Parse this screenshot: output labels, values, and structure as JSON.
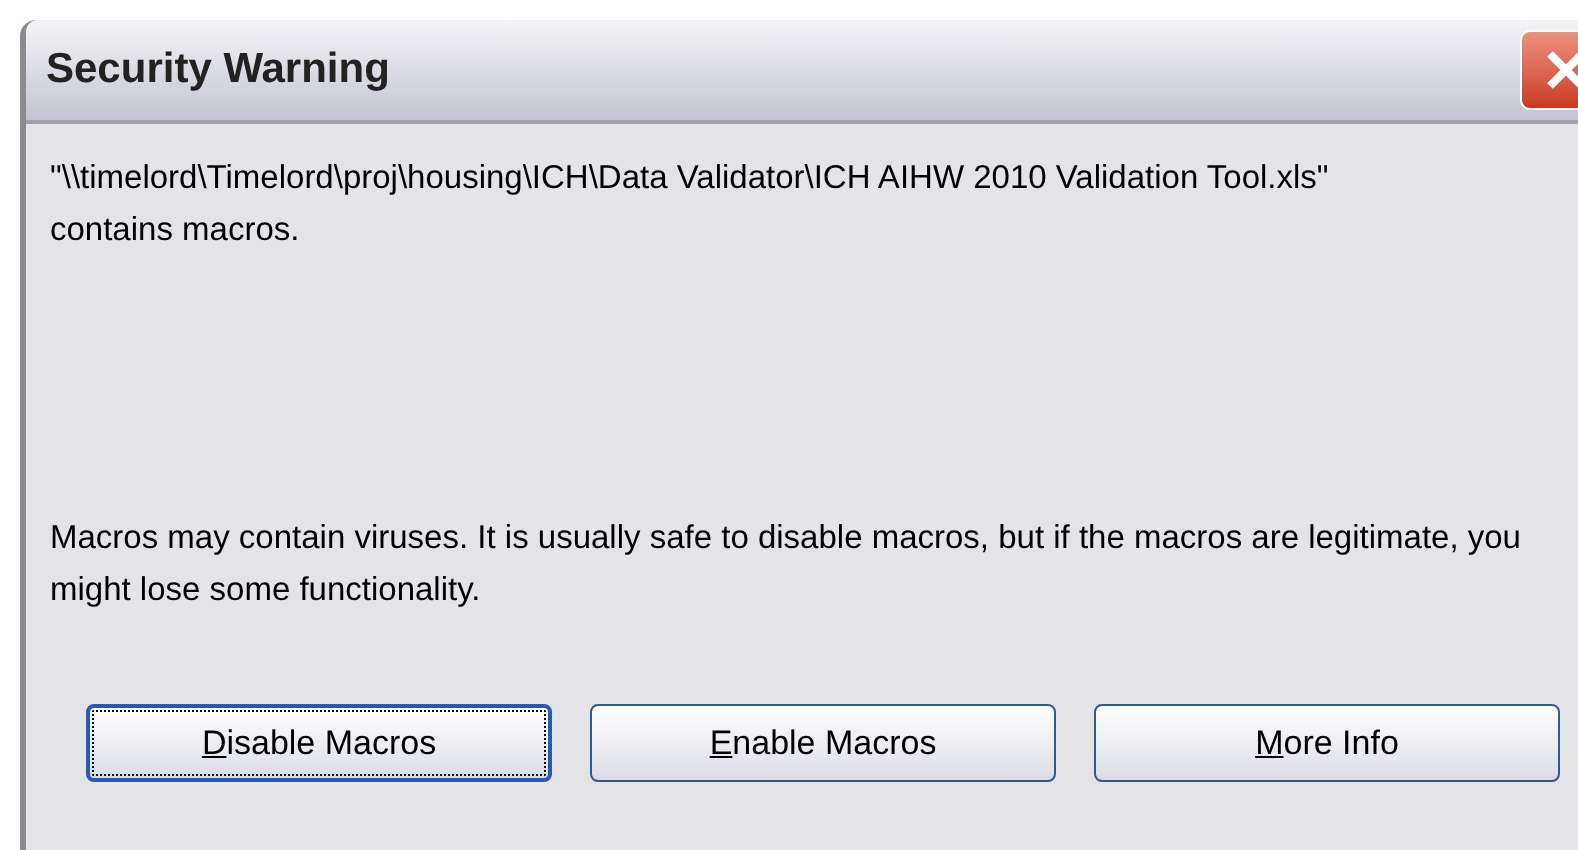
{
  "window": {
    "title": "Security Warning"
  },
  "message": {
    "file_notice": "\"\\\\timelord\\Timelord\\proj\\housing\\ICH\\Data Validator\\ICH AIHW 2010 Validation Tool.xls\" contains macros.",
    "warning": "Macros may contain viruses. It is usually safe to disable macros, but if the macros are legitimate, you might lose some functionality."
  },
  "buttons": [
    {
      "label": "Disable Macros",
      "focused": true,
      "first_letter_underlined": true
    },
    {
      "label": "Enable Macros",
      "focused": false,
      "first_letter_underlined": true
    },
    {
      "label": "More Info",
      "focused": false,
      "first_letter_underlined": true
    }
  ]
}
